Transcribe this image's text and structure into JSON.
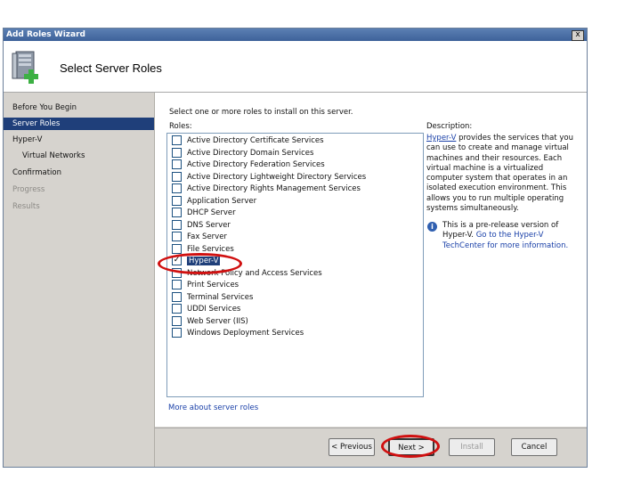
{
  "window": {
    "title": "Add Roles Wizard",
    "close_glyph": "x"
  },
  "header": {
    "title": "Select Server Roles",
    "icon": "server-add-icon"
  },
  "sidebar": {
    "items": [
      {
        "label": "Before You Begin",
        "state": "normal"
      },
      {
        "label": "Server Roles",
        "state": "active"
      },
      {
        "label": "Hyper-V",
        "state": "normal"
      },
      {
        "label": "Virtual Networks",
        "state": "normal"
      },
      {
        "label": "Confirmation",
        "state": "normal"
      },
      {
        "label": "Progress",
        "state": "disabled"
      },
      {
        "label": "Results",
        "state": "disabled"
      }
    ]
  },
  "main": {
    "instruction": "Select one or more roles to install on this server.",
    "roles_label": "Roles:",
    "roles": [
      {
        "label": "Active Directory Certificate Services",
        "checked": false
      },
      {
        "label": "Active Directory Domain Services",
        "checked": false
      },
      {
        "label": "Active Directory Federation Services",
        "checked": false
      },
      {
        "label": "Active Directory Lightweight Directory Services",
        "checked": false
      },
      {
        "label": "Active Directory Rights Management Services",
        "checked": false
      },
      {
        "label": "Application Server",
        "checked": false
      },
      {
        "label": "DHCP Server",
        "checked": false
      },
      {
        "label": "DNS Server",
        "checked": false
      },
      {
        "label": "Fax Server",
        "checked": false
      },
      {
        "label": "File Services",
        "checked": false
      },
      {
        "label": "Hyper-V",
        "checked": true
      },
      {
        "label": "Network Policy and Access Services",
        "checked": false
      },
      {
        "label": "Print Services",
        "checked": false
      },
      {
        "label": "Terminal Services",
        "checked": false
      },
      {
        "label": "UDDI Services",
        "checked": false
      },
      {
        "label": "Web Server (IIS)",
        "checked": false
      },
      {
        "label": "Windows Deployment Services",
        "checked": false
      }
    ],
    "more_link": "More about server roles",
    "description_label": "Description:",
    "description_link": "Hyper-V",
    "description_text": " provides the services that you can use to create and manage virtual machines and their resources. Each virtual machine is a virtualized computer system that operates in an isolated execution environment. This allows you to run multiple operating systems simultaneously.",
    "info_text": "This is a pre-release version of Hyper-V. ",
    "info_link": "Go to the Hyper-V TechCenter for more information."
  },
  "buttons": {
    "previous": "< Previous",
    "next": "Next >",
    "install": "Install",
    "cancel": "Cancel"
  },
  "colors": {
    "selection": "#1f3f7a",
    "annotation": "#d01010",
    "link": "#1a40a8"
  }
}
